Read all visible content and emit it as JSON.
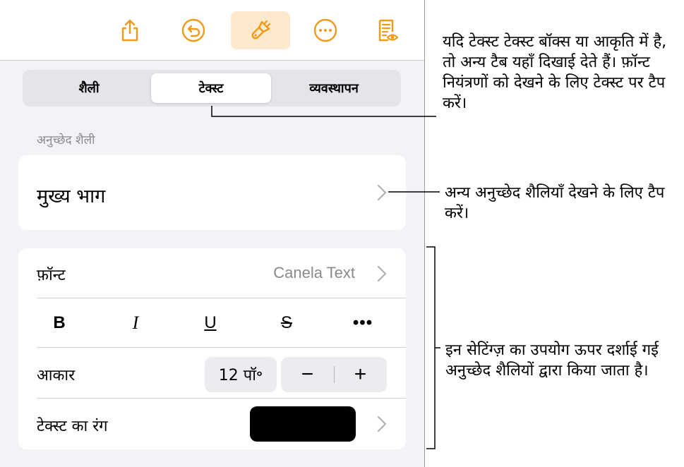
{
  "toolbar": {
    "buttons": [
      {
        "icon": "share-icon"
      },
      {
        "icon": "undo-icon"
      },
      {
        "icon": "format-brush-icon",
        "active": true
      },
      {
        "icon": "more-icon"
      },
      {
        "icon": "document-view-icon"
      }
    ],
    "accent_color": "#f09a1a",
    "active_bg": "#fde9cc"
  },
  "tabs": {
    "items": [
      "शैली",
      "टेक्स्ट",
      "व्यवस्थापन"
    ],
    "selected": "टेक्स्ट"
  },
  "paragraph_style": {
    "section_label": "अनुच्छेद शैली",
    "current": "मुख्य भाग"
  },
  "format": {
    "font_label": "फ़ॉन्ट",
    "font_value": "Canela Text",
    "style_buttons": [
      "B",
      "I",
      "U",
      "S",
      "•••"
    ],
    "size_label": "आकार",
    "size_value": "12 पॉ॰",
    "decrease": "−",
    "increase": "+",
    "color_label": "टेक्स्ट का रंग",
    "color_value": "#000000"
  },
  "callouts": {
    "tabs": "यदि टेक्स्ट टेक्स्ट बॉक्स या आकृति में है, तो अन्य टैब यहाँ दिखाई देते हैं। फ़ॉन्ट नियंत्रणों को देखने के लिए टेक्स्ट पर टैप करें।",
    "styles": "अन्य अनुच्छेद शैलियाँ देखने के लिए टैप करें।",
    "settings": "इन सेटिंग्ज़ का उपयोग ऊपर दर्शाई गई अनुच्छेद शैलियों द्वारा किया जाता है।"
  }
}
